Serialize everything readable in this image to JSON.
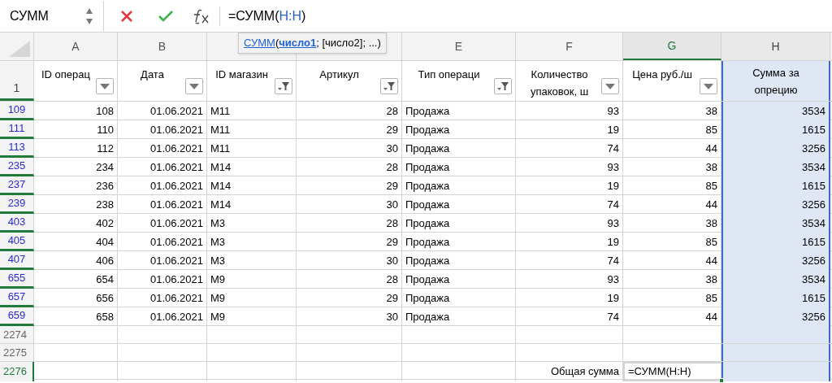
{
  "formula_bar": {
    "name_box": "СУММ",
    "formula_parts": [
      {
        "text": "=СУММ(",
        "kind": "plain"
      },
      {
        "text": "H:H",
        "kind": "ref"
      },
      {
        "text": ")",
        "kind": "plain"
      }
    ],
    "tooltip": [
      {
        "text": "СУММ",
        "kind": "link"
      },
      {
        "text": "(",
        "kind": "plain"
      },
      {
        "text": "число1",
        "kind": "current"
      },
      {
        "text": "; [число2]; ...)",
        "kind": "plain"
      }
    ]
  },
  "columns": [
    {
      "letter": "A",
      "kind": "number",
      "selected": false,
      "in_range": false,
      "header": "ID операц",
      "filter_button": true,
      "filtered": false
    },
    {
      "letter": "B",
      "kind": "number",
      "selected": false,
      "in_range": false,
      "header": "Дата",
      "filter_button": true,
      "filtered": false
    },
    {
      "kind": "text",
      "selected": false,
      "in_range": false,
      "header": "ID магазин",
      "filter_button": true,
      "filtered": true
    },
    {
      "kind": "number",
      "selected": false,
      "in_range": false,
      "header": "Артикул",
      "filter_button": true,
      "filtered": true
    },
    {
      "letter": "E",
      "kind": "text",
      "selected": false,
      "in_range": false,
      "header": "Тип операци",
      "filter_button": true,
      "filtered": true
    },
    {
      "letter": "F",
      "kind": "number",
      "selected": false,
      "in_range": false,
      "header": "Количество упаковок, ш",
      "filter_button": true,
      "filtered": false
    },
    {
      "letter": "G",
      "kind": "number",
      "selected": true,
      "in_range": false,
      "header": "Цена руб./ш",
      "filter_button": true,
      "filtered": false
    },
    {
      "letter": "H",
      "kind": "number",
      "selected": false,
      "in_range": true,
      "header": "Сумма за опрецию"
    }
  ],
  "header_row_number": "1",
  "rows": [
    {
      "number": "109",
      "filtered": true,
      "selected": false,
      "cells": [
        "108",
        "01.06.2021",
        "M11",
        "28",
        "Продажа",
        "93",
        "38",
        "3534"
      ]
    },
    {
      "number": "111",
      "filtered": true,
      "selected": false,
      "cells": [
        "110",
        "01.06.2021",
        "M11",
        "29",
        "Продажа",
        "19",
        "85",
        "1615"
      ]
    },
    {
      "number": "113",
      "filtered": true,
      "selected": false,
      "cells": [
        "112",
        "01.06.2021",
        "M11",
        "30",
        "Продажа",
        "74",
        "44",
        "3256"
      ]
    },
    {
      "number": "235",
      "filtered": true,
      "selected": false,
      "cells": [
        "234",
        "01.06.2021",
        "M14",
        "28",
        "Продажа",
        "93",
        "38",
        "3534"
      ]
    },
    {
      "number": "237",
      "filtered": true,
      "selected": false,
      "cells": [
        "236",
        "01.06.2021",
        "M14",
        "29",
        "Продажа",
        "19",
        "85",
        "1615"
      ]
    },
    {
      "number": "239",
      "filtered": true,
      "selected": false,
      "cells": [
        "238",
        "01.06.2021",
        "M14",
        "30",
        "Продажа",
        "74",
        "44",
        "3256"
      ]
    },
    {
      "number": "403",
      "filtered": true,
      "selected": false,
      "cells": [
        "402",
        "01.06.2021",
        "M3",
        "28",
        "Продажа",
        "93",
        "38",
        "3534"
      ]
    },
    {
      "number": "405",
      "filtered": true,
      "selected": false,
      "cells": [
        "404",
        "01.06.2021",
        "M3",
        "29",
        "Продажа",
        "19",
        "85",
        "1615"
      ]
    },
    {
      "number": "407",
      "filtered": true,
      "selected": false,
      "cells": [
        "406",
        "01.06.2021",
        "M3",
        "30",
        "Продажа",
        "74",
        "44",
        "3256"
      ]
    },
    {
      "number": "655",
      "filtered": true,
      "selected": false,
      "cells": [
        "654",
        "01.06.2021",
        "M9",
        "28",
        "Продажа",
        "93",
        "38",
        "3534"
      ]
    },
    {
      "number": "657",
      "filtered": true,
      "selected": false,
      "cells": [
        "656",
        "01.06.2021",
        "M9",
        "29",
        "Продажа",
        "19",
        "85",
        "1615"
      ]
    },
    {
      "number": "659",
      "filtered": true,
      "selected": false,
      "cells": [
        "658",
        "01.06.2021",
        "M9",
        "30",
        "Продажа",
        "74",
        "44",
        "3256"
      ]
    },
    {
      "number": "2274",
      "filtered": false,
      "selected": false,
      "cells": [
        "",
        "",
        "",
        "",
        "",
        "",
        "",
        ""
      ]
    },
    {
      "number": "2275",
      "filtered": false,
      "selected": false,
      "cells": [
        "",
        "",
        "",
        "",
        "",
        "",
        "",
        ""
      ]
    },
    {
      "number": "2276",
      "filtered": false,
      "selected": true,
      "cells": [
        "",
        "",
        "",
        "",
        "",
        "Общая сумма",
        "=СУММ(H:H)",
        ""
      ]
    }
  ]
}
